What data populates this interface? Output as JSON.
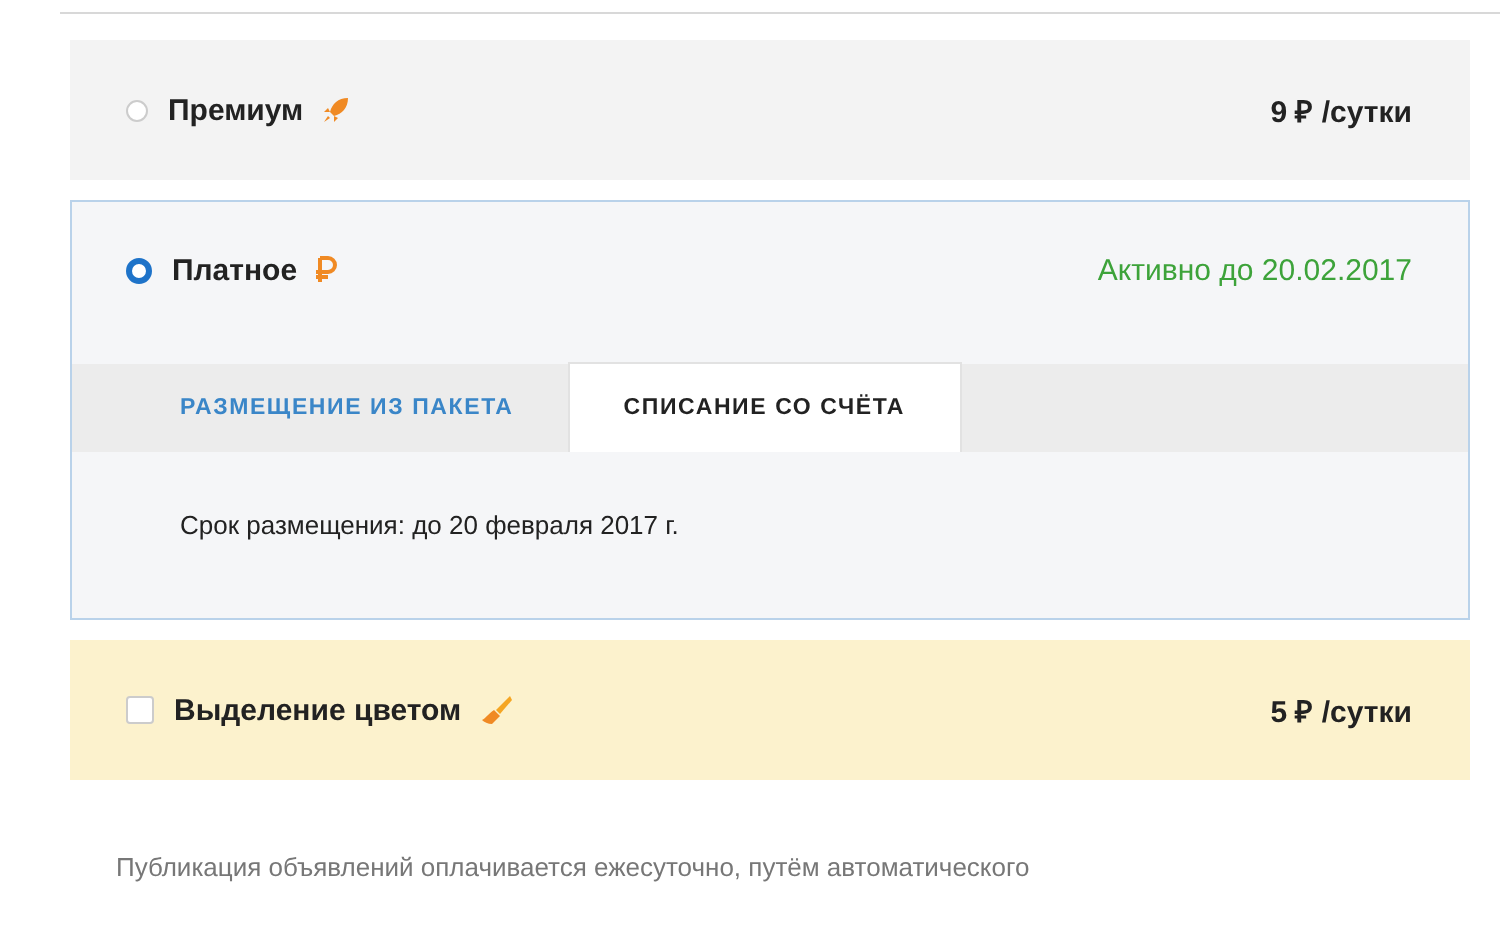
{
  "options": [
    {
      "kind": "radio",
      "label": "Премиум",
      "selected": false,
      "price": "9 ₽ /сутки"
    },
    {
      "kind": "radio",
      "label": "Платное",
      "selected": true,
      "status": "Активно до 20.02.2017",
      "tabs": [
        {
          "label": "РАЗМЕЩЕНИЕ ИЗ ПАКЕТА",
          "selected": false
        },
        {
          "label": "СПИСАНИЕ СО СЧЁТА",
          "selected": true
        }
      ],
      "detail": "Срок размещения: до 20 февраля 2017 г."
    },
    {
      "kind": "checkbox",
      "label": "Выделение цветом",
      "checked": false,
      "price": "5 ₽ /сутки"
    }
  ],
  "footnote": "Публикация объявлений оплачивается ежесуточно, путём автоматического"
}
